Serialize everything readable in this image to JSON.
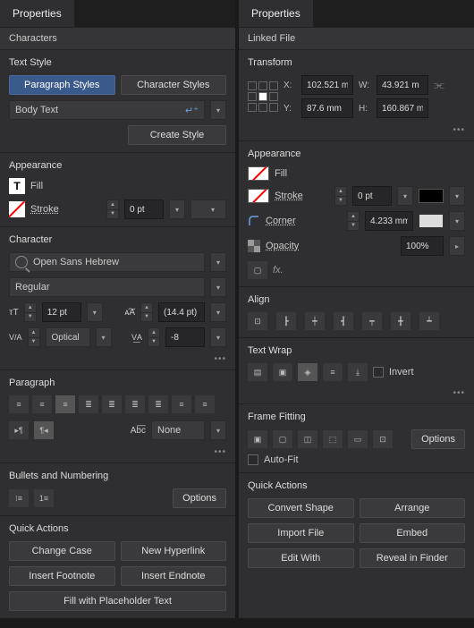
{
  "left": {
    "tab": "Properties",
    "section_characters": "Characters",
    "text_style": {
      "title": "Text Style",
      "paragraph_btn": "Paragraph Styles",
      "character_btn": "Character Styles",
      "current": "Body Text",
      "create_btn": "Create Style"
    },
    "appearance": {
      "title": "Appearance",
      "fill": "Fill",
      "stroke": "Stroke",
      "stroke_val": "0 pt"
    },
    "character": {
      "title": "Character",
      "font": "Open Sans Hebrew",
      "weight": "Regular",
      "size": "12 pt",
      "leading": "(14.4 pt)",
      "kerning": "Optical",
      "tracking": "-8"
    },
    "paragraph": {
      "title": "Paragraph",
      "hyphen": "None"
    },
    "bullets": {
      "title": "Bullets and Numbering",
      "options": "Options"
    },
    "quick": {
      "title": "Quick Actions",
      "change_case": "Change Case",
      "new_hyperlink": "New Hyperlink",
      "insert_footnote": "Insert Footnote",
      "insert_endnote": "Insert Endnote",
      "fill_placeholder": "Fill with Placeholder Text"
    }
  },
  "right": {
    "tab": "Properties",
    "section_linked": "Linked File",
    "transform": {
      "title": "Transform",
      "x_label": "X:",
      "y_label": "Y:",
      "w_label": "W:",
      "h_label": "H:",
      "x": "102.521 m",
      "y": "87.6 mm",
      "w": "43.921 m",
      "h": "160.867 m"
    },
    "appearance": {
      "title": "Appearance",
      "fill": "Fill",
      "stroke": "Stroke",
      "stroke_val": "0 pt",
      "corner": "Corner",
      "corner_val": "4.233 mm",
      "opacity": "Opacity",
      "opacity_val": "100%"
    },
    "align": {
      "title": "Align"
    },
    "textwrap": {
      "title": "Text Wrap",
      "invert": "Invert"
    },
    "frame_fitting": {
      "title": "Frame Fitting",
      "options": "Options",
      "autofit": "Auto-Fit"
    },
    "quick": {
      "title": "Quick Actions",
      "convert_shape": "Convert Shape",
      "arrange": "Arrange",
      "import_file": "Import File",
      "embed": "Embed",
      "edit_with": "Edit With",
      "reveal": "Reveal in Finder"
    }
  }
}
